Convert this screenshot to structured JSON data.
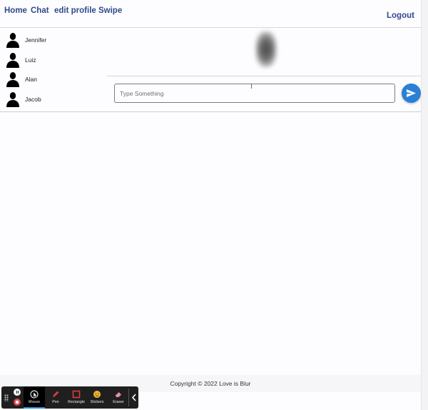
{
  "nav": {
    "links": [
      "Home",
      "Chat",
      "edit profile",
      "Swipe"
    ],
    "logout": "Logout"
  },
  "contacts": [
    {
      "name": "Jennifer"
    },
    {
      "name": "Luiz"
    },
    {
      "name": "Alan"
    },
    {
      "name": "Jacob"
    }
  ],
  "composer": {
    "placeholder": "Type Something",
    "send_icon": "send-icon"
  },
  "footer": {
    "text": "Copyright © 2022 Love is Blur"
  },
  "recorder_toolbar": {
    "tools": [
      {
        "label": "Mouse",
        "icon": "mouse-cursor-icon",
        "active": true
      },
      {
        "label": "Pen",
        "icon": "pen-icon"
      },
      {
        "label": "Rectangle",
        "icon": "rectangle-icon"
      },
      {
        "label": "Stickers",
        "icon": "sticker-icon"
      },
      {
        "label": "Eraser",
        "icon": "eraser-icon"
      }
    ]
  },
  "colors": {
    "nav_link": "#2f4a8e",
    "send_button": "#2a7fd6",
    "background": "#fdfcfe"
  }
}
